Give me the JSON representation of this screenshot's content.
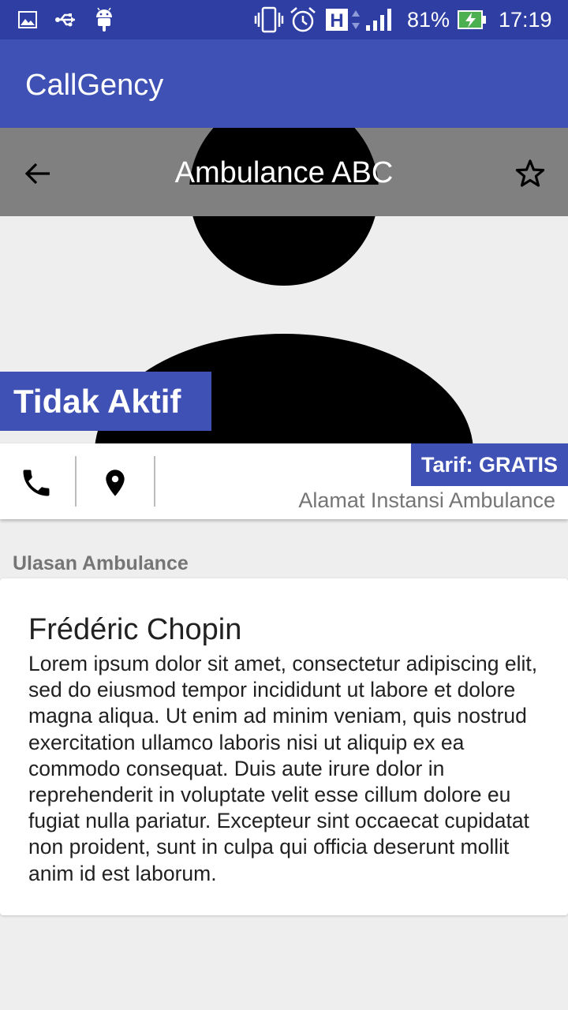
{
  "status_bar": {
    "battery": "81%",
    "time": "17:19",
    "network": "H",
    "icons": [
      "image-icon",
      "usb-icon",
      "android-icon",
      "vibrate-icon",
      "alarm-icon",
      "network-h-icon",
      "signal-icon",
      "battery-charging-icon"
    ]
  },
  "app_bar": {
    "title": "CallGency"
  },
  "header": {
    "title": "Ambulance ABC",
    "back_icon": "arrow-back-icon",
    "favorite_icon": "star-outline-icon",
    "avatar_icon": "person-placeholder-icon"
  },
  "status": {
    "label": "Tidak Aktif"
  },
  "info": {
    "call_icon": "phone-icon",
    "location_icon": "map-pin-icon",
    "tariff": "Tarif: GRATIS",
    "address": "Alamat Instansi Ambulance"
  },
  "reviews": {
    "section_title": "Ulasan Ambulance",
    "items": [
      {
        "author": "Frédéric Chopin",
        "text": "Lorem ipsum dolor sit amet, consectetur adipiscing elit, sed do eiusmod tempor incididunt ut labore et dolore magna aliqua. Ut enim ad minim veniam, quis nostrud exercitation ullamco laboris nisi ut aliquip ex ea commodo consequat. Duis aute irure dolor in reprehenderit in voluptate velit esse cillum dolore eu fugiat nulla pariatur. Excepteur sint occaecat cupidatat non proident, sunt in culpa qui officia deserunt mollit anim id est laborum."
      }
    ]
  },
  "colors": {
    "primary": "#3f51b5",
    "primary_dark": "#2f3ea3",
    "background": "#eeeeee",
    "secondary_text": "#757575"
  }
}
